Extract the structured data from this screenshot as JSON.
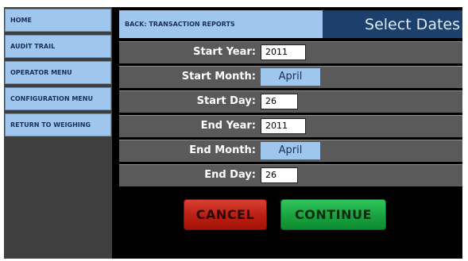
{
  "sidebar": {
    "items": [
      {
        "label": "HOME"
      },
      {
        "label": "AUDIT TRAIL"
      },
      {
        "label": "OPERATOR MENU"
      },
      {
        "label": "CONFIGURATION MENU"
      },
      {
        "label": "RETURN TO WEIGHING"
      }
    ]
  },
  "header": {
    "back_label": "BACK: TRANSACTION REPORTS",
    "title": "Select Dates"
  },
  "form": {
    "start_year": {
      "label": "Start Year:",
      "value": "2011"
    },
    "start_month": {
      "label": "Start Month:",
      "value": "April"
    },
    "start_day": {
      "label": "Start Day:",
      "value": "26"
    },
    "end_year": {
      "label": "End Year:",
      "value": "2011"
    },
    "end_month": {
      "label": "End Month:",
      "value": "April"
    },
    "end_day": {
      "label": "End Day:",
      "value": "26"
    }
  },
  "actions": {
    "cancel_label": "CANCEL",
    "continue_label": "CONTINUE"
  },
  "colors": {
    "nav_button": "#9fc7ee",
    "title_bar": "#1d3f6b",
    "row_background": "#5a5a5a",
    "cancel": "#c0271a",
    "continue": "#1fae48"
  }
}
